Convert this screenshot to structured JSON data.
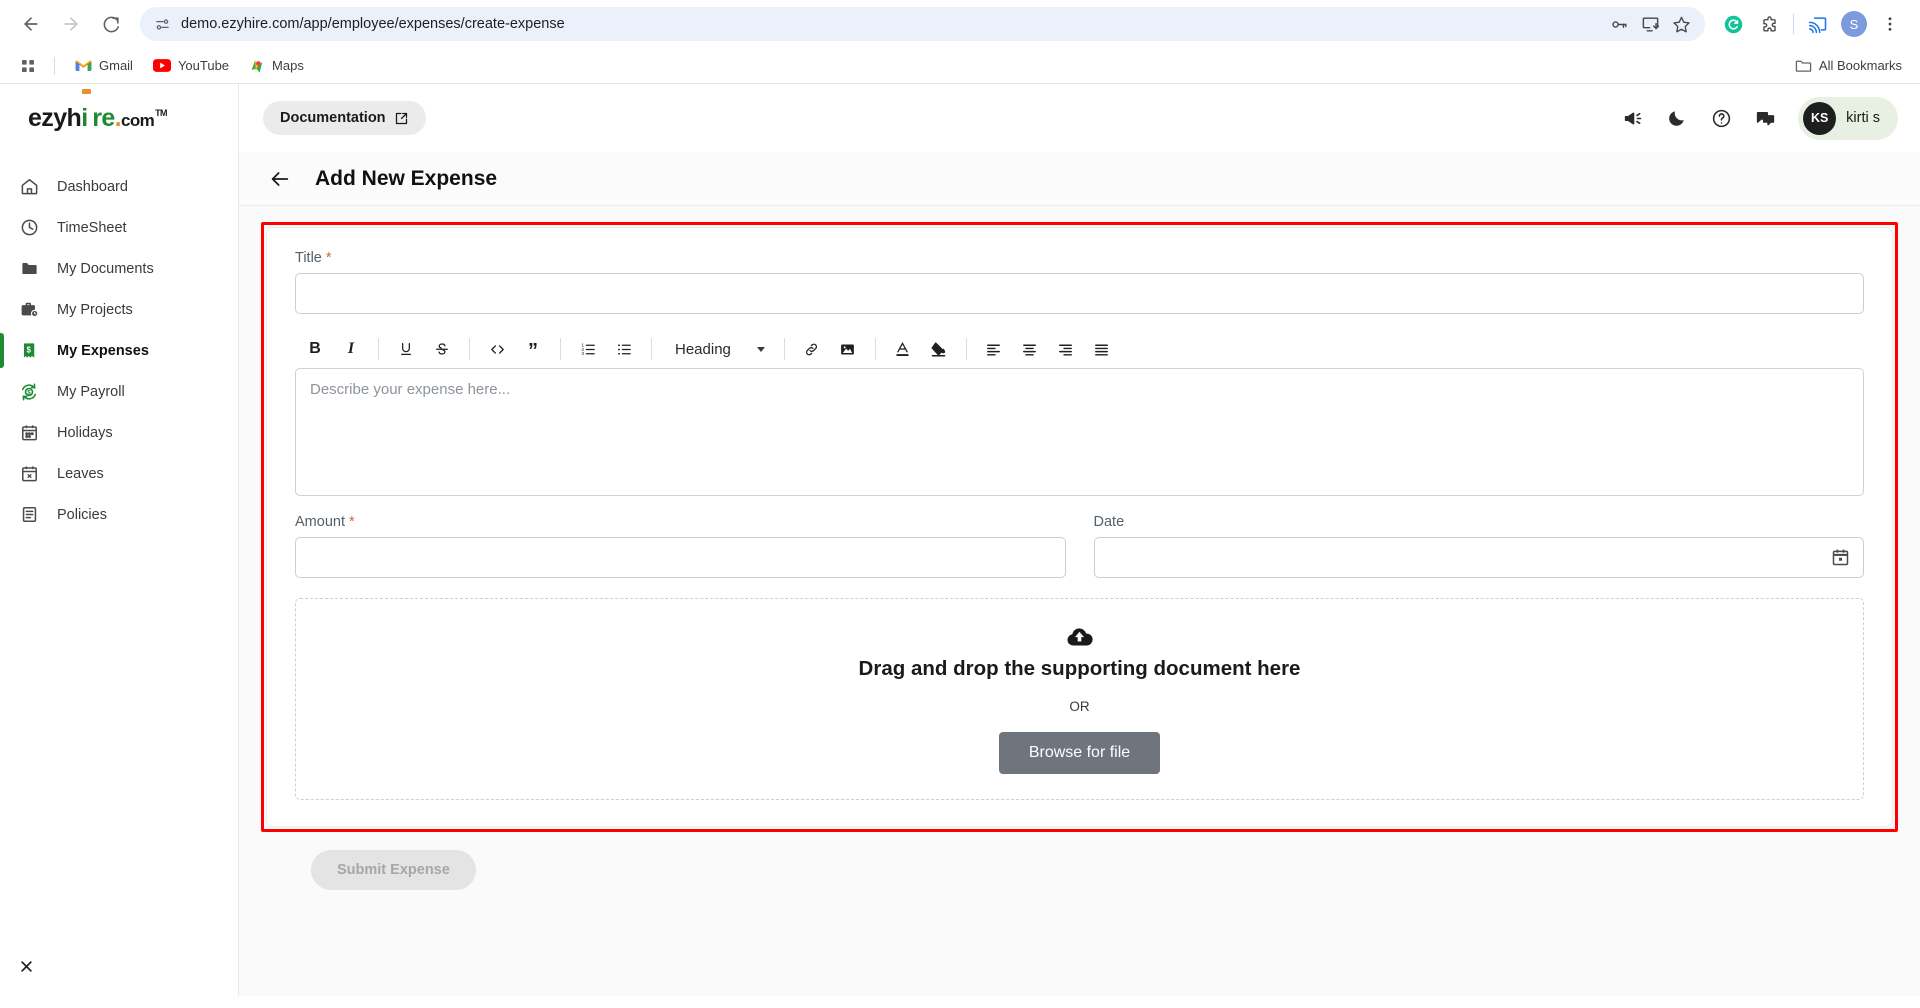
{
  "browser": {
    "url": "demo.ezyhire.com/app/employee/expenses/create-expense",
    "back_icon": "back-arrow-icon",
    "forward_icon": "forward-arrow-icon",
    "reload_icon": "reload-icon",
    "site_info_icon": "site-settings-icon",
    "toolbar_icons": [
      "password-key-icon",
      "install-app-icon",
      "bookmark-star-icon",
      "grammarly-icon",
      "extensions-puzzle-icon",
      "cast-icon"
    ],
    "profile_initial": "S",
    "menu_icon": "three-dot-menu-icon",
    "bookmarks": [
      {
        "label": "Gmail",
        "icon": "gmail-icon"
      },
      {
        "label": "YouTube",
        "icon": "youtube-icon"
      },
      {
        "label": "Maps",
        "icon": "maps-icon"
      }
    ],
    "all_bookmarks_label": "All Bookmarks",
    "apps_icon": "apps-grid-icon",
    "folder_icon": "folder-icon"
  },
  "sidebar": {
    "logo": {
      "part1": "ezyh",
      "tie": "i",
      "part2": "re",
      "dot": ".",
      "com": "com",
      "tm": "TM"
    },
    "items": [
      {
        "label": "Dashboard",
        "icon": "home-icon",
        "active": false
      },
      {
        "label": "TimeSheet",
        "icon": "clock-icon",
        "active": false
      },
      {
        "label": "My Documents",
        "icon": "folder-icon",
        "active": false
      },
      {
        "label": "My Projects",
        "icon": "briefcase-clock-icon",
        "active": false
      },
      {
        "label": "My Expenses",
        "icon": "receipt-dollar-icon",
        "active": true
      },
      {
        "label": "My Payroll",
        "icon": "currency-refresh-icon",
        "active": false
      },
      {
        "label": "Holidays",
        "icon": "calendar-icon",
        "active": false
      },
      {
        "label": "Leaves",
        "icon": "calendar-x-icon",
        "active": false
      },
      {
        "label": "Policies",
        "icon": "document-lines-icon",
        "active": false
      }
    ],
    "close_icon": "close-icon",
    "accent_color": "#1f8a34"
  },
  "topbar": {
    "documentation_label": "Documentation",
    "documentation_icon": "external-link-icon",
    "icons": [
      "announcement-megaphone-icon",
      "dark-mode-moon-icon",
      "help-question-icon",
      "chat-bubble-icon"
    ],
    "user": {
      "initials": "KS",
      "name": "kirti s"
    }
  },
  "page": {
    "back_icon": "back-arrow-icon",
    "title": "Add New Expense",
    "annotation_color": "#ff0000"
  },
  "form": {
    "title_field": {
      "label": "Title",
      "required": "*",
      "value": "",
      "placeholder": ""
    },
    "editor": {
      "placeholder": "Describe your expense here...",
      "value": "",
      "heading_select": {
        "value": "Heading",
        "caret_icon": "chevron-down-icon"
      },
      "toolbar": [
        {
          "name": "bold-button",
          "glyph": "B"
        },
        {
          "name": "italic-button",
          "glyph": "I"
        },
        {
          "name": "underline-button",
          "glyph": "U"
        },
        {
          "name": "strikethrough-button",
          "glyph": "S"
        },
        {
          "name": "code-button",
          "glyph": "<>"
        },
        {
          "name": "blockquote-button",
          "glyph": "”"
        },
        {
          "name": "ordered-list-button",
          "glyph": ""
        },
        {
          "name": "bullet-list-button",
          "glyph": ""
        },
        {
          "name": "link-button",
          "glyph": ""
        },
        {
          "name": "image-button",
          "glyph": ""
        },
        {
          "name": "text-color-button",
          "glyph": "A"
        },
        {
          "name": "highlight-color-button",
          "glyph": ""
        },
        {
          "name": "align-left-button",
          "glyph": ""
        },
        {
          "name": "align-center-button",
          "glyph": ""
        },
        {
          "name": "align-right-button",
          "glyph": ""
        },
        {
          "name": "align-justify-button",
          "glyph": ""
        }
      ]
    },
    "amount_field": {
      "label": "Amount",
      "required": "*",
      "value": "",
      "placeholder": ""
    },
    "date_field": {
      "label": "Date",
      "required": "",
      "value": "",
      "placeholder": "",
      "icon": "calendar-picker-icon"
    },
    "dropzone": {
      "icon": "cloud-upload-icon",
      "title": "Drag and drop the supporting document here",
      "or": "OR",
      "browse_label": "Browse for file"
    },
    "submit_label": "Submit Expense",
    "submit_disabled": true
  }
}
